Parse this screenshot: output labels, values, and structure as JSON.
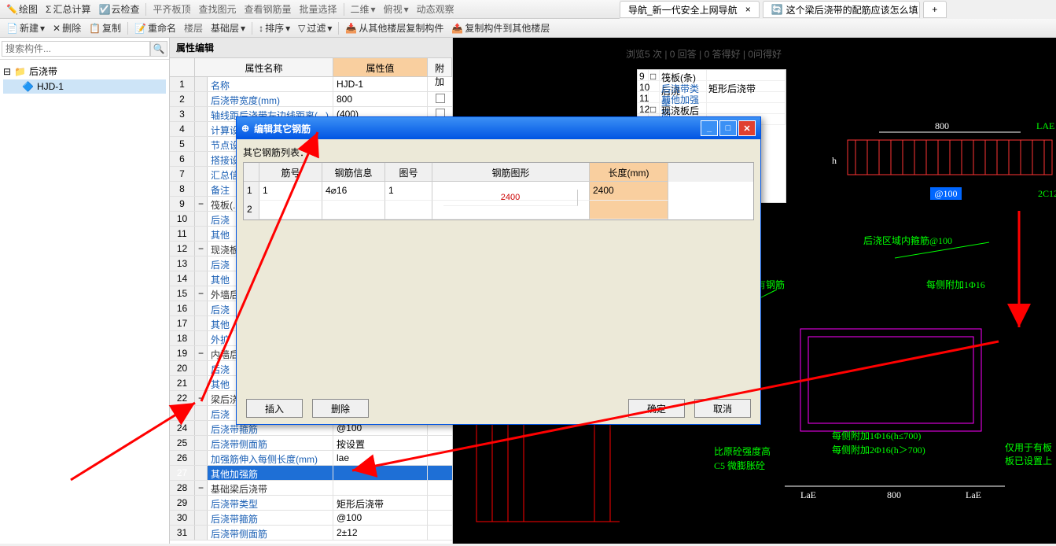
{
  "toolbar1": {
    "items": [
      "绘图",
      "汇总计算",
      "云检查",
      "平齐板顶",
      "查找图元",
      "查看钢筋量",
      "批量选择",
      "二维",
      "俯视",
      "动态观察"
    ]
  },
  "toolbar2": {
    "items": [
      "新建",
      "删除",
      "复制",
      "重命名",
      "楼层",
      "基础层",
      "排序",
      "过滤",
      "从其他楼层复制构件",
      "复制构件到其他楼层"
    ]
  },
  "browser": {
    "tab1": "导航_新一代安全上网导航",
    "tab2": "这个梁后浇带的配筋应该怎么填",
    "stats": "浏览5 次 | 0 回答 | 0 答得好 | 0问得好"
  },
  "search": {
    "placeholder": "搜索构件..."
  },
  "tree": {
    "root": "后浇带",
    "child": "HJD-1"
  },
  "prop": {
    "title": "属性编辑",
    "head_name": "属性名称",
    "head_val": "属性值",
    "head_att": "附加",
    "rows": [
      {
        "n": "1",
        "name": "名称",
        "val": "HJD-1"
      },
      {
        "n": "2",
        "name": "后浇带宽度(mm)",
        "val": "800"
      },
      {
        "n": "3",
        "name": "轴线距后浇带左边线距离(...)",
        "val": "(400)"
      },
      {
        "n": "4",
        "name": "计算设",
        "val": ""
      },
      {
        "n": "5",
        "name": "节点设",
        "val": ""
      },
      {
        "n": "6",
        "name": "搭接设",
        "val": ""
      },
      {
        "n": "7",
        "name": "汇总信",
        "val": ""
      },
      {
        "n": "8",
        "name": "备注",
        "val": ""
      },
      {
        "n": "9",
        "name": "筏板(...)",
        "val": "",
        "group": true
      },
      {
        "n": "10",
        "name": "后浇",
        "val": ""
      },
      {
        "n": "11",
        "name": "其他",
        "val": ""
      },
      {
        "n": "12",
        "name": "现浇板",
        "val": "",
        "group": true
      },
      {
        "n": "13",
        "name": "后浇",
        "val": ""
      },
      {
        "n": "14",
        "name": "其他",
        "val": ""
      },
      {
        "n": "15",
        "name": "外墙后",
        "val": "",
        "group": true
      },
      {
        "n": "16",
        "name": "后浇",
        "val": ""
      },
      {
        "n": "17",
        "name": "其他",
        "val": ""
      },
      {
        "n": "18",
        "name": "外扩",
        "val": ""
      },
      {
        "n": "19",
        "name": "内墙后",
        "val": "",
        "group": true
      },
      {
        "n": "20",
        "name": "后浇",
        "val": ""
      },
      {
        "n": "21",
        "name": "其他",
        "val": ""
      },
      {
        "n": "22",
        "name": "梁后浇",
        "val": "",
        "group": true
      },
      {
        "n": "23",
        "name": "后浇",
        "val": ""
      },
      {
        "n": "24",
        "name": "后浇带箍筋",
        "val": "@100"
      },
      {
        "n": "25",
        "name": "后浇带侧面筋",
        "val": "按设置"
      },
      {
        "n": "26",
        "name": "加强筋伸入每侧长度(mm)",
        "val": "lae"
      },
      {
        "n": "27",
        "name": "其他加强筋",
        "val": "",
        "sel": true
      },
      {
        "n": "28",
        "name": "基础梁后浇带",
        "val": "",
        "group": true
      },
      {
        "n": "29",
        "name": "后浇带类型",
        "val": "矩形后浇带"
      },
      {
        "n": "30",
        "name": "后浇带箍筋",
        "val": "@100"
      },
      {
        "n": "31",
        "name": "后浇带侧面筋",
        "val": "2±12"
      }
    ]
  },
  "dialog": {
    "title": "编辑其它钢筋",
    "list_label": "其它钢筋列表：",
    "head": {
      "num": "筋号",
      "info": "钢筋信息",
      "fig": "图号",
      "shape": "钢筋图形",
      "len": "长度(mm)"
    },
    "rows": [
      {
        "i": "1",
        "num": "1",
        "info": "4⌀16",
        "fig": "1",
        "shape": "2400",
        "len": "2400"
      },
      {
        "i": "2",
        "num": "",
        "info": "",
        "fig": "",
        "shape": "",
        "len": ""
      }
    ],
    "btn_insert": "插入",
    "btn_delete": "删除",
    "btn_ok": "确定",
    "btn_cancel": "取消"
  },
  "cad": {
    "txt_800": "800",
    "txt_lae": "LAE",
    "txt_at100": "@100",
    "txt_2c12": "2C12",
    "txt_region": "后浇区域内箍筋@100",
    "txt_orig": "梁原有钢筋",
    "txt_each": "每侧附加1Φ16",
    "txt_strong": "比原砼强度高\nC5 微膨胀砼",
    "txt_add1": "每侧附加1Φ16(h≤700)",
    "txt_add2": "每侧附加2Φ16(h＞700)",
    "txt_only": "仅用于有板\n板已设置上",
    "txt_lae2": "LaE",
    "txt_800b": "800",
    "txt_lae3": "LaE",
    "thumb_hjd": "后浇带类型",
    "thumb_gjd": "矩形后浇带",
    "thumb_other": "其他加强筋"
  }
}
